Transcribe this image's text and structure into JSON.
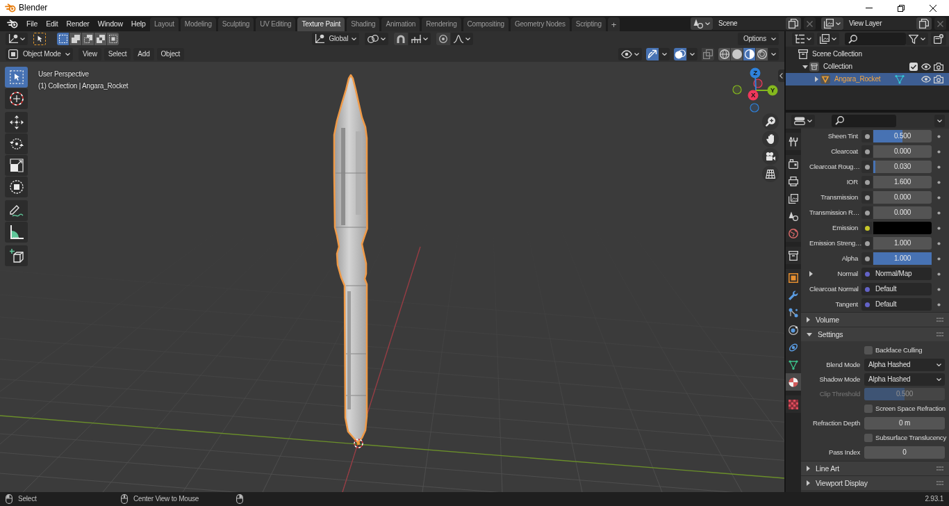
{
  "window": {
    "title": "Blender"
  },
  "menu": [
    "File",
    "Edit",
    "Render",
    "Window",
    "Help"
  ],
  "workspaces": [
    {
      "label": "Layout",
      "selected": false
    },
    {
      "label": "Modeling",
      "selected": false
    },
    {
      "label": "Sculpting",
      "selected": false
    },
    {
      "label": "UV Editing",
      "selected": false
    },
    {
      "label": "Texture Paint",
      "selected": true
    },
    {
      "label": "Shading",
      "selected": false
    },
    {
      "label": "Animation",
      "selected": false
    },
    {
      "label": "Rendering",
      "selected": false
    },
    {
      "label": "Compositing",
      "selected": false
    },
    {
      "label": "Geometry Nodes",
      "selected": false
    },
    {
      "label": "Scripting",
      "selected": false
    }
  ],
  "add_workspace": "+",
  "scene": {
    "name": "Scene"
  },
  "view_layer": {
    "name": "View Layer"
  },
  "viewport": {
    "select_modes": [
      {
        "kind": "new",
        "selected": true
      },
      {
        "kind": "extend",
        "selected": false
      },
      {
        "kind": "subtract",
        "selected": false
      },
      {
        "kind": "invert",
        "selected": false
      },
      {
        "kind": "intersect",
        "selected": false
      }
    ],
    "orientation": "Global",
    "options": "Options",
    "mode": "Object Mode",
    "menus": [
      "View",
      "Select",
      "Add",
      "Object"
    ],
    "toggles": [
      {
        "kind": "gizmos",
        "on": true
      },
      {
        "kind": "overlays",
        "on": true
      },
      {
        "kind": "xray",
        "on": false
      }
    ],
    "shading": [
      {
        "kind": "wireframe",
        "selected": false
      },
      {
        "kind": "solid",
        "selected": false
      },
      {
        "kind": "material",
        "selected": true
      },
      {
        "kind": "rendered",
        "selected": false
      }
    ],
    "tool_groups": [
      {
        "tools": [
          {
            "kind": "select_box",
            "selected": true
          },
          {
            "kind": "cursor",
            "selected": false
          }
        ]
      },
      {
        "tools": [
          {
            "kind": "move",
            "selected": false
          },
          {
            "kind": "rotate",
            "selected": false
          },
          {
            "kind": "scale",
            "selected": false
          },
          {
            "kind": "transform",
            "selected": false
          }
        ]
      },
      {
        "tools": [
          {
            "kind": "annotate",
            "selected": false
          },
          {
            "kind": "measure",
            "selected": false
          }
        ]
      },
      {
        "tools": [
          {
            "kind": "add_cube",
            "selected": false
          }
        ]
      }
    ],
    "overlay_text": [
      "User Perspective",
      "(1) Collection | Angara_Rocket"
    ],
    "gizmo_axes": [
      {
        "label": "X",
        "color": "#f0385a"
      },
      {
        "label": "Y",
        "color": "#84b81e"
      },
      {
        "label": "Z",
        "color": "#2f82dc"
      }
    ]
  },
  "outliner": {
    "items": [
      {
        "kind": "scene_collection",
        "name": "Scene Collection",
        "selected": false,
        "children": [
          {
            "kind": "collection",
            "name": "Collection",
            "selected": false,
            "expanded": true,
            "checked": true,
            "children": [
              {
                "kind": "object",
                "name": "Angara_Rocket",
                "selected": true,
                "expanded": false
              }
            ]
          }
        ]
      }
    ]
  },
  "properties": {
    "tab_groups": [
      {
        "tabs": [
          {
            "kind": "tool",
            "selected": false
          }
        ]
      },
      {
        "tabs": [
          {
            "kind": "render",
            "selected": false
          },
          {
            "kind": "output",
            "selected": false
          },
          {
            "kind": "view_layer",
            "selected": false
          },
          {
            "kind": "scene",
            "selected": false
          },
          {
            "kind": "world",
            "selected": false
          }
        ]
      },
      {
        "tabs": [
          {
            "kind": "collection",
            "selected": false
          }
        ]
      },
      {
        "tabs": [
          {
            "kind": "object",
            "selected": false
          },
          {
            "kind": "modifiers",
            "selected": false
          },
          {
            "kind": "particles",
            "selected": false
          },
          {
            "kind": "physics",
            "selected": false
          },
          {
            "kind": "constraints",
            "selected": false
          },
          {
            "kind": "data",
            "selected": false
          },
          {
            "kind": "material",
            "selected": true
          }
        ]
      },
      {
        "tabs": [
          {
            "kind": "texture",
            "selected": false
          }
        ]
      }
    ],
    "sockets": [
      {
        "kind": "slider",
        "label": "Sheen Tint",
        "value": "0.500",
        "level": 0.5,
        "color": "#a1a1a1"
      },
      {
        "kind": "slider",
        "label": "Clearcoat",
        "value": "0.000",
        "level": 0,
        "color": "#a1a1a1"
      },
      {
        "kind": "slider",
        "label": "Clearcoat Roug…",
        "value": "0.030",
        "level": 0.03,
        "color": "#a1a1a1"
      },
      {
        "kind": "number",
        "label": "IOR",
        "value": "1.600",
        "color": "#a1a1a1"
      },
      {
        "kind": "slider",
        "label": "Transmission",
        "value": "0.000",
        "level": 0,
        "color": "#a1a1a1"
      },
      {
        "kind": "slider",
        "label": "Transmission R…",
        "value": "0.000",
        "level": 0,
        "color": "#a1a1a1"
      },
      {
        "kind": "color",
        "label": "Emission",
        "swatch": {
          "color": "#000000"
        },
        "color": "#c7c729"
      },
      {
        "kind": "number",
        "label": "Emission Streng…",
        "value": "1.000",
        "color": "#a1a1a1"
      },
      {
        "kind": "slider",
        "label": "Alpha",
        "value": "1.000",
        "level": 1,
        "color": "#a1a1a1"
      },
      {
        "kind": "link",
        "label": "Normal",
        "value": "Normal/Map",
        "color": "#6363c7",
        "expanded": false
      },
      {
        "kind": "link",
        "label": "Clearcoat Normal",
        "value": "Default",
        "color": "#6363c7"
      },
      {
        "kind": "link",
        "label": "Tangent",
        "value": "Default",
        "color": "#6363c7"
      }
    ],
    "panels": [
      {
        "title": "Volume",
        "expanded": false
      },
      {
        "title": "Settings",
        "expanded": true,
        "rows": [
          {
            "kind": "checkbox",
            "label": "Backface Culling",
            "checked": false,
            "disabled": false
          },
          {
            "kind": "dropdown",
            "label": "Blend Mode",
            "value": "Alpha Hashed",
            "disabled": false
          },
          {
            "kind": "dropdown",
            "label": "Shadow Mode",
            "value": "Alpha Hashed",
            "disabled": false
          },
          {
            "kind": "slider",
            "label": "Clip Threshold",
            "value": "0.500",
            "level": 0.5,
            "disabled": true
          },
          {
            "kind": "checkbox",
            "label": "Screen Space Refraction",
            "checked": false,
            "disabled": false
          },
          {
            "kind": "number",
            "label": "Refraction Depth",
            "value": "0 m",
            "disabled": false
          },
          {
            "kind": "checkbox",
            "label": "Subsurface Translucency",
            "checked": false,
            "disabled": false
          },
          {
            "kind": "number",
            "label": "Pass Index",
            "value": "0",
            "disabled": false
          }
        ]
      },
      {
        "title": "Line Art",
        "expanded": false
      },
      {
        "title": "Viewport Display",
        "expanded": false
      }
    ]
  },
  "status_bar": {
    "hints": [
      {
        "kind": "mouse_left",
        "label": "Select"
      },
      {
        "kind": "mouse_middle",
        "label": "Center View to Mouse"
      },
      {
        "kind": "mouse_right"
      }
    ],
    "version": "2.93.1"
  }
}
